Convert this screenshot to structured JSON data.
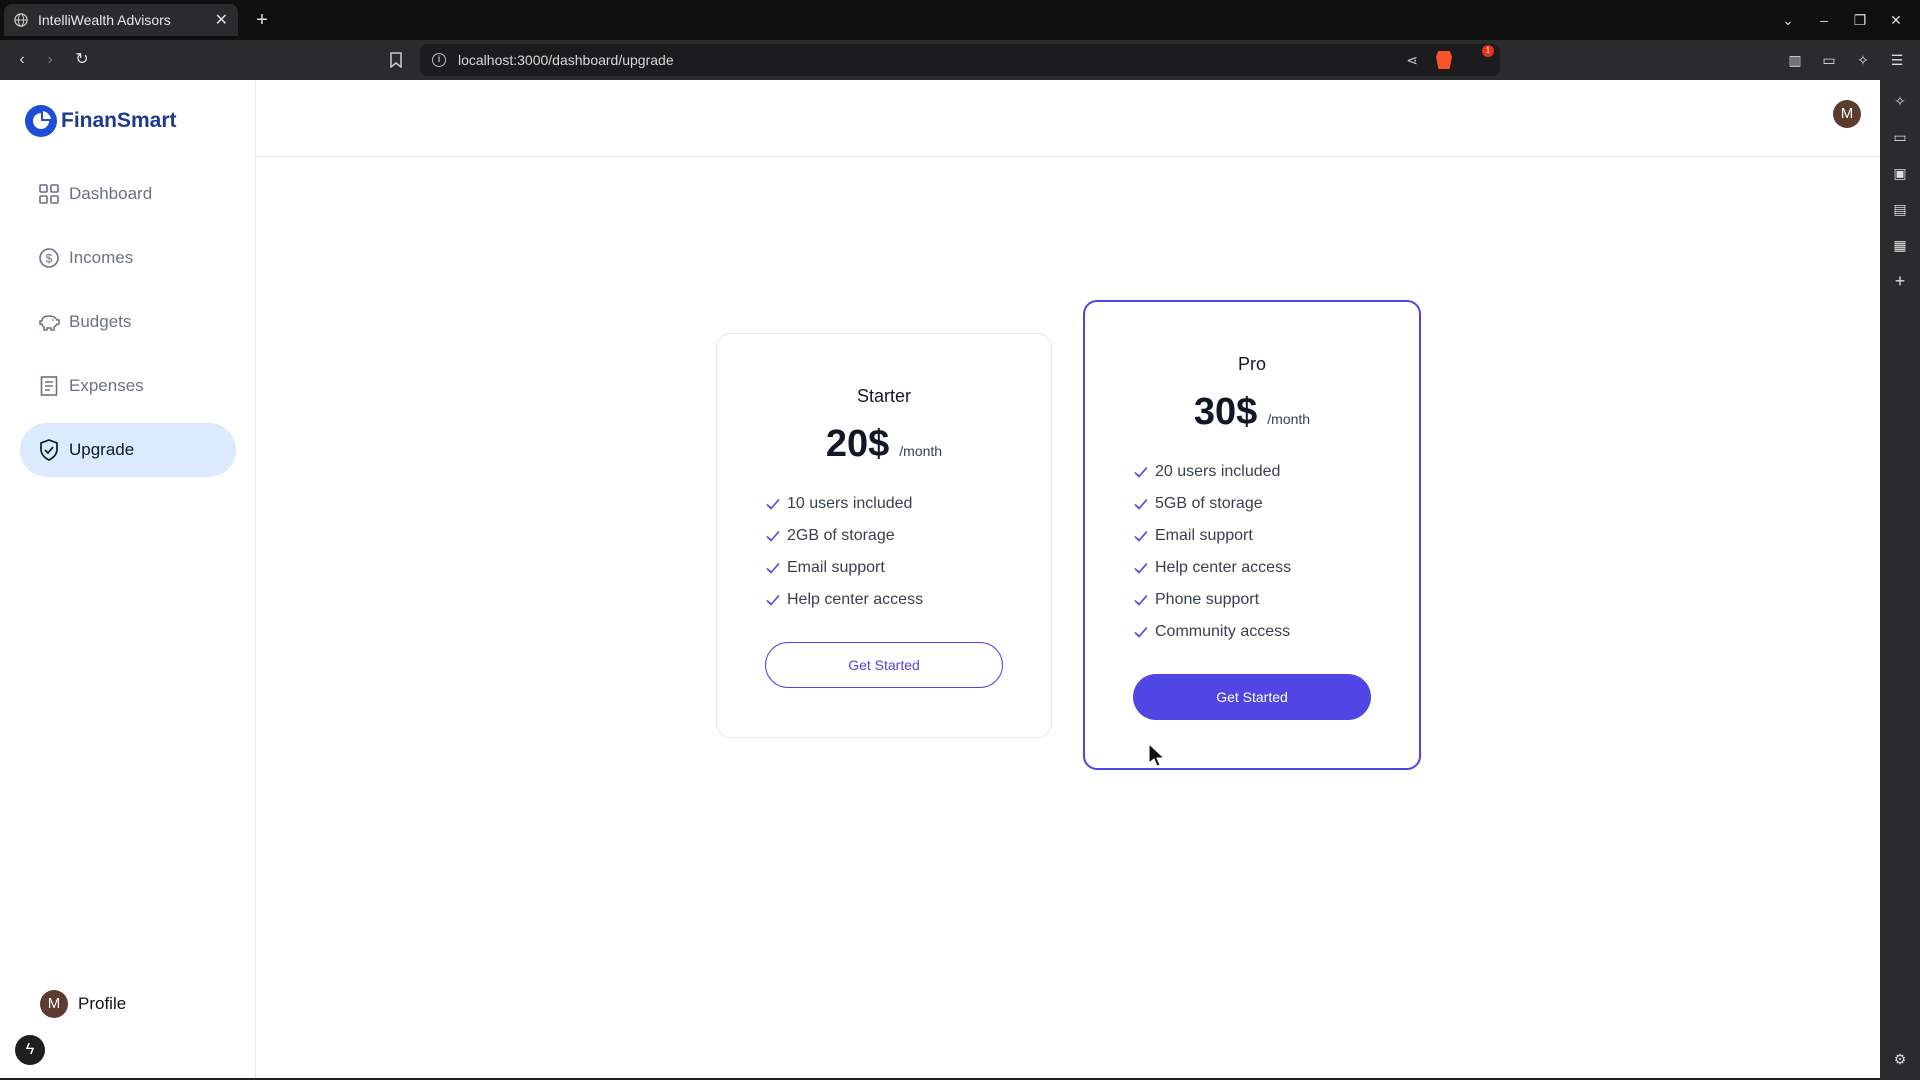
{
  "browser": {
    "tab_title": "IntelliWealth Advisors",
    "url": "localhost:3000/dashboard/upgrade",
    "rewards_badge": "1"
  },
  "sidebar": {
    "brand": "FinanSmart",
    "items": [
      {
        "label": "Dashboard",
        "icon": "grid-icon",
        "active": false
      },
      {
        "label": "Incomes",
        "icon": "dollar-circle-icon",
        "active": false
      },
      {
        "label": "Budgets",
        "icon": "piggy-bank-icon",
        "active": false
      },
      {
        "label": "Expenses",
        "icon": "receipt-icon",
        "active": false
      },
      {
        "label": "Upgrade",
        "icon": "shield-check-icon",
        "active": true
      }
    ],
    "profile": {
      "initial": "M",
      "label": "Profile"
    }
  },
  "header": {
    "avatar_initial": "M"
  },
  "plans": [
    {
      "name": "Starter",
      "price": "20$",
      "period": "/month",
      "features": [
        "10 users included",
        "2GB of storage",
        "Email support",
        "Help center access"
      ],
      "cta": "Get Started",
      "featured": false
    },
    {
      "name": "Pro",
      "price": "30$",
      "period": "/month",
      "features": [
        "20 users included",
        "5GB of storage",
        "Email support",
        "Help center access",
        "Phone support",
        "Community access"
      ],
      "cta": "Get Started",
      "featured": true
    }
  ],
  "colors": {
    "accent": "#4f46e5",
    "active_nav_bg": "#dbeafe",
    "brand": "#1e3a8a"
  }
}
